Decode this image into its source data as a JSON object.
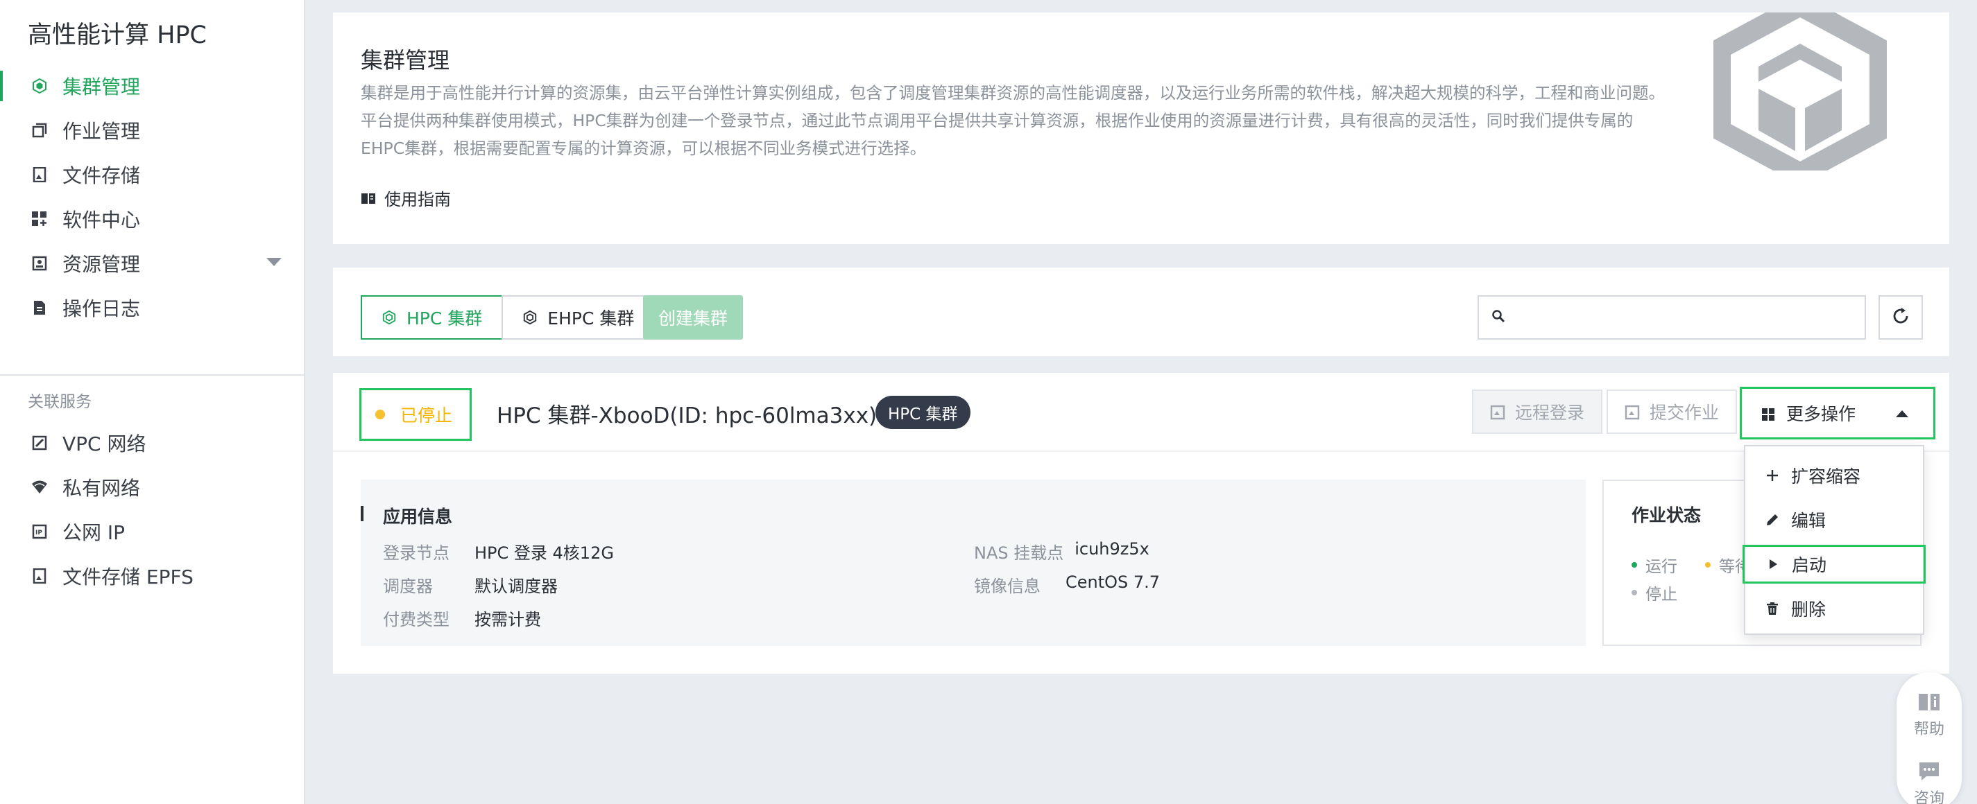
{
  "app": {
    "title": "高性能计算 HPC"
  },
  "sidebar": {
    "items": [
      {
        "label": "集群管理",
        "icon": "cluster-icon",
        "active": true
      },
      {
        "label": "作业管理",
        "icon": "job-icon"
      },
      {
        "label": "文件存储",
        "icon": "storage-icon"
      },
      {
        "label": "软件中心",
        "icon": "software-icon"
      },
      {
        "label": "资源管理",
        "icon": "resource-icon"
      },
      {
        "label": "操作日志",
        "icon": "log-icon"
      }
    ],
    "section_label": "关联服务",
    "related": [
      {
        "label": "VPC 网络",
        "icon": "vpc-icon"
      },
      {
        "label": "私有网络",
        "icon": "wifi-icon"
      },
      {
        "label": "公网 IP",
        "icon": "ip-icon"
      },
      {
        "label": "文件存储 EPFS",
        "icon": "epfs-icon"
      }
    ]
  },
  "intro": {
    "title": "集群管理",
    "lines": [
      "集群是用于高性能并行计算的资源集，由云平台弹性计算实例组成，包含了调度管理集群资源的高性能调度器，以及运行业务所需的软件栈，解决超大规模的科学，工程和商业问题。",
      "平台提供两种集群使用模式，HPC集群为创建一个登录节点，通过此节点调用平台提供共享计算资源，根据作业使用的资源量进行计费，具有很高的灵活性，同时我们提供专属的",
      "EHPC集群，根据需要配置专属的计算资源，可以根据不同业务模式进行选择。"
    ],
    "guide_label": "使用指南"
  },
  "toolbar": {
    "tab_hpc": "HPC 集群",
    "tab_ehpc": "EHPC 集群",
    "create_label": "创建集群",
    "search_placeholder": ""
  },
  "cluster": {
    "status": "已停止",
    "name": "HPC 集群-XbooD(ID: hpc-60lma3xx)",
    "type_badge": "HPC 集群",
    "remote_label": "远程登录",
    "submit_label": "提交作业",
    "more_label": "更多操作",
    "app_info": {
      "title": "应用信息",
      "login_node_key": "登录节点",
      "login_node_val": "HPC 登录 4核12G",
      "scheduler_key": "调度器",
      "scheduler_val": "默认调度器",
      "billing_key": "付费类型",
      "billing_val": "按需计费",
      "nas_key": "NAS 挂载点",
      "nas_val": "icuh9z5x",
      "image_key": "镜像信息",
      "image_val": "CentOS 7.7"
    },
    "job_status": {
      "title": "作业状态",
      "running": "运行",
      "waiting": "等待",
      "stopped": "停止"
    }
  },
  "dropdown": {
    "items": [
      {
        "label": "扩容缩容",
        "icon": "plus-icon"
      },
      {
        "label": "编辑",
        "icon": "pencil-icon"
      },
      {
        "label": "启动",
        "icon": "play-icon"
      },
      {
        "label": "删除",
        "icon": "trash-icon"
      }
    ]
  },
  "float": {
    "help": "帮助",
    "consult": "咨询"
  },
  "colors": {
    "accent": "#20a65c",
    "stopped": "#f5c12e",
    "badge": "#343c4b",
    "highlight_border": "#22c55e"
  }
}
